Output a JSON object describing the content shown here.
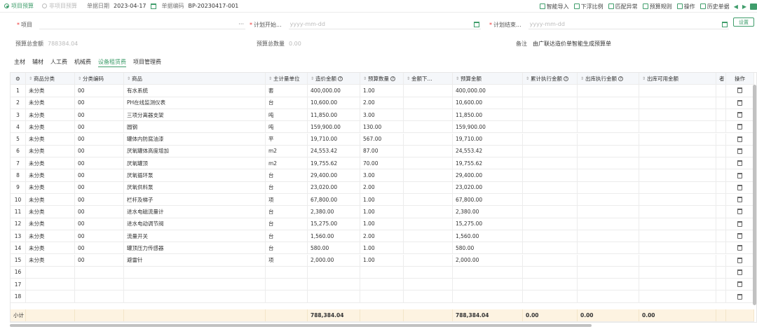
{
  "topbar": {
    "radio_project": "项目预算",
    "radio_nonproject": "非项目预算",
    "date_label": "单据日期",
    "date_value": "2023-04-17",
    "code_label": "单据编码",
    "code_value": "BP-20230417-001",
    "tools": [
      "智能导入",
      "下浮比例",
      "匹配异常",
      "预算规则",
      "操作",
      "历史单据"
    ]
  },
  "form": {
    "project_label": "项目",
    "plan_start_label": "计划开始...",
    "plan_start_placeholder": "yyyy-mm-dd",
    "plan_end_label": "计划结束...",
    "plan_end_placeholder": "yyyy-mm-dd",
    "settings_label": "设置",
    "total_amount_label": "预算总金额",
    "total_amount_value": "788384.04",
    "total_qty_label": "预算总数量",
    "total_qty_value": "0.00",
    "remark_label": "备注",
    "remark_value": "由广联达造价单智能生成预算单"
  },
  "tabs": [
    "主材",
    "辅材",
    "人工费",
    "机械费",
    "设备租赁费",
    "项目管理费"
  ],
  "active_tab": 4,
  "table": {
    "headers": [
      "商品分类",
      "分类编码",
      "商品",
      "主计量单位",
      "造价金额",
      "预算数量",
      "金额下...",
      "预算金额",
      "累计执行金额",
      "出库执行金额",
      "出库可用金额",
      "者",
      "操作"
    ],
    "rows": [
      [
        "1",
        "未分类",
        "00",
        "有水系统",
        "套",
        "400,000.00",
        "1.00",
        "",
        "400,000.00"
      ],
      [
        "2",
        "未分类",
        "00",
        "PH在线监测仪表",
        "台",
        "10,600.00",
        "2.00",
        "",
        "10,600.00"
      ],
      [
        "3",
        "未分类",
        "00",
        "三项分离器支架",
        "吨",
        "11,850.00",
        "3.00",
        "",
        "11,850.00"
      ],
      [
        "4",
        "未分类",
        "00",
        "圆钢",
        "吨",
        "159,900.00",
        "130.00",
        "",
        "159,900.00"
      ],
      [
        "5",
        "未分类",
        "00",
        "罐体内防腐油漆",
        "平",
        "19,710.00",
        "567.00",
        "",
        "19,710.00"
      ],
      [
        "6",
        "未分类",
        "00",
        "厌氧罐体高度增加",
        "m2",
        "24,553.42",
        "87.00",
        "",
        "24,553.42"
      ],
      [
        "7",
        "未分类",
        "00",
        "厌氧罐顶",
        "m2",
        "19,755.62",
        "70.00",
        "",
        "19,755.62"
      ],
      [
        "8",
        "未分类",
        "00",
        "厌氧循环泵",
        "台",
        "29,400.00",
        "3.00",
        "",
        "29,400.00"
      ],
      [
        "9",
        "未分类",
        "00",
        "厌氧供料泵",
        "台",
        "23,020.00",
        "2.00",
        "",
        "23,020.00"
      ],
      [
        "10",
        "未分类",
        "00",
        "栏杆及梯子",
        "项",
        "67,800.00",
        "1.00",
        "",
        "67,800.00"
      ],
      [
        "11",
        "未分类",
        "00",
        "进水电磁流量计",
        "台",
        "2,380.00",
        "1.00",
        "",
        "2,380.00"
      ],
      [
        "12",
        "未分类",
        "00",
        "进水电动调节阀",
        "台",
        "15,275.00",
        "1.00",
        "",
        "15,275.00"
      ],
      [
        "13",
        "未分类",
        "00",
        "流量开关",
        "台",
        "1,560.00",
        "2.00",
        "",
        "1,560.00"
      ],
      [
        "14",
        "未分类",
        "00",
        "罐顶压力传感器",
        "台",
        "580.00",
        "1.00",
        "",
        "580.00"
      ],
      [
        "15",
        "未分类",
        "00",
        "避雷针",
        "项",
        "2,000.00",
        "1.00",
        "",
        "2,000.00"
      ],
      [
        "16",
        "",
        "",
        "",
        "",
        "",
        "",
        "",
        ""
      ],
      [
        "17",
        "",
        "",
        "",
        "",
        "",
        "",
        "",
        ""
      ],
      [
        "18",
        "",
        "",
        "",
        "",
        "",
        "",
        "",
        ""
      ]
    ],
    "footer": {
      "label": "小计",
      "cost_total": "788,384.04",
      "budget_total": "788,384.04",
      "cum_exec": "0.00",
      "out_exec": "0.00",
      "out_avail": "0.00"
    }
  }
}
